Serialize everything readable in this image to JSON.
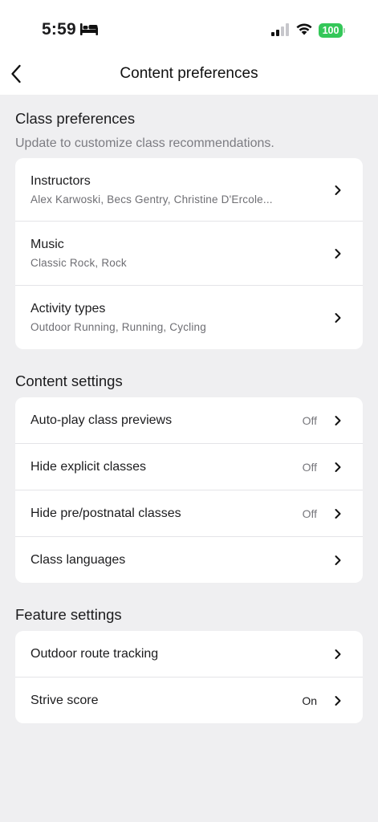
{
  "status": {
    "time": "5:59",
    "battery": "100"
  },
  "nav": {
    "title": "Content preferences"
  },
  "class_prefs": {
    "title": "Class preferences",
    "subtitle": "Update to customize class recommendations.",
    "items": [
      {
        "label": "Instructors",
        "detail": "Alex Karwoski, Becs Gentry, Christine D'Ercole..."
      },
      {
        "label": "Music",
        "detail": "Classic Rock, Rock"
      },
      {
        "label": "Activity types",
        "detail": "Outdoor Running, Running, Cycling"
      }
    ]
  },
  "content_settings": {
    "title": "Content settings",
    "items": [
      {
        "label": "Auto-play class previews",
        "value": "Off"
      },
      {
        "label": "Hide explicit classes",
        "value": "Off"
      },
      {
        "label": "Hide pre/postnatal classes",
        "value": "Off"
      },
      {
        "label": "Class languages",
        "value": ""
      }
    ]
  },
  "feature_settings": {
    "title": "Feature settings",
    "items": [
      {
        "label": "Outdoor route tracking",
        "value": ""
      },
      {
        "label": "Strive score",
        "value": "On"
      }
    ]
  },
  "colors": {
    "background": "#efeff1",
    "card": "#ffffff",
    "battery": "#34c759",
    "secondary_text": "#7c7c82"
  },
  "icons": [
    "bed-icon",
    "signal-icon",
    "wifi-icon",
    "back-chevron-icon",
    "chevron-right-icon"
  ]
}
